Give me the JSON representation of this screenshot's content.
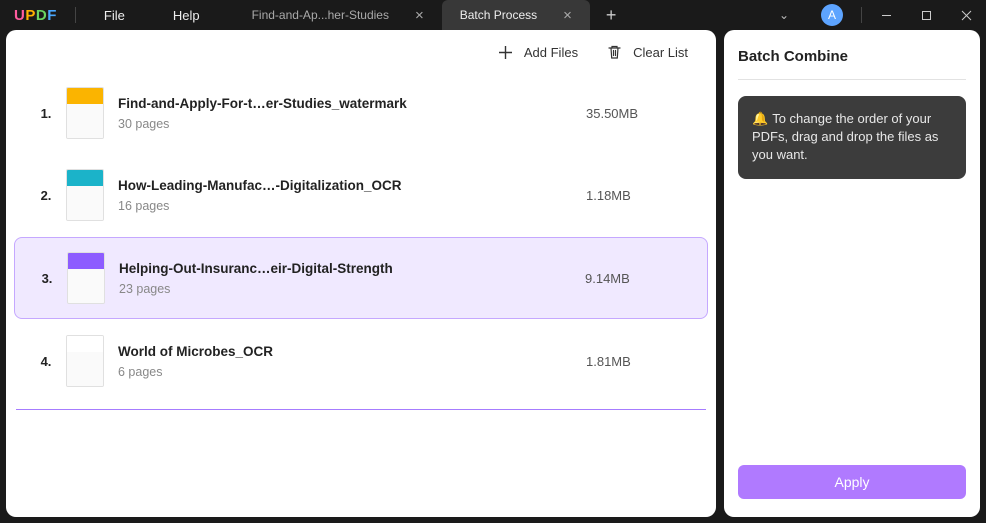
{
  "logo": {
    "u": "U",
    "p": "P",
    "d": "D",
    "f": "F"
  },
  "menu": {
    "file": "File",
    "help": "Help"
  },
  "tabs": [
    {
      "label": "Find-and-Ap...her-Studies",
      "active": false
    },
    {
      "label": "Batch Process",
      "active": true
    }
  ],
  "avatar_letter": "A",
  "toolbar": {
    "add_files": "Add Files",
    "clear_list": "Clear List"
  },
  "files": [
    {
      "idx": "1.",
      "name": "Find-and-Apply-For-t…er-Studies_watermark",
      "pages": "30 pages",
      "size": "35.50MB",
      "thumb_color": "#fbb400",
      "selected": false
    },
    {
      "idx": "2.",
      "name": "How-Leading-Manufac…-Digitalization_OCR",
      "pages": "16 pages",
      "size": "1.18MB",
      "thumb_color": "#1bb3c9",
      "selected": false
    },
    {
      "idx": "3.",
      "name": "Helping-Out-Insuranc…eir-Digital-Strength",
      "pages": "23 pages",
      "size": "9.14MB",
      "thumb_color": "#8d5cff",
      "selected": true
    },
    {
      "idx": "4.",
      "name": "World of Microbes_OCR",
      "pages": "6 pages",
      "size": "1.81MB",
      "thumb_color": "#ffffff",
      "selected": false
    }
  ],
  "right_panel": {
    "title": "Batch Combine",
    "hint": "To change the order of your PDFs, drag and drop the files as you want.",
    "apply": "Apply"
  }
}
